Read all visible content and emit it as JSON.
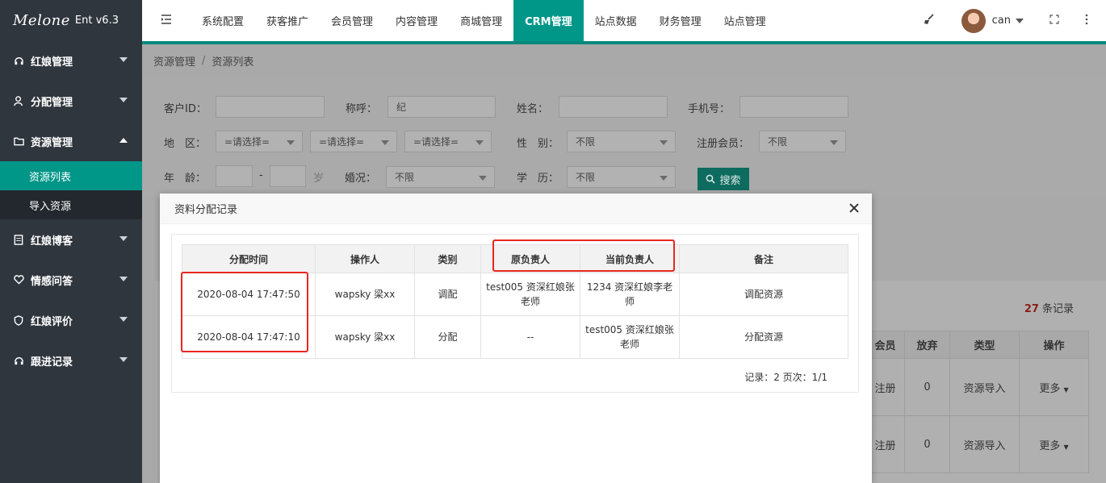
{
  "app": {
    "logo_text": "Melone",
    "version": "Ent v6.3"
  },
  "sidebar": {
    "items": [
      {
        "label": "红娘管理",
        "expanded": false
      },
      {
        "label": "分配管理",
        "expanded": false
      },
      {
        "label": "资源管理",
        "expanded": true,
        "children": [
          {
            "label": "资源列表",
            "active": true
          },
          {
            "label": "导入资源",
            "active": false
          }
        ]
      },
      {
        "label": "红娘博客",
        "expanded": false
      },
      {
        "label": "情感问答",
        "expanded": false
      },
      {
        "label": "红娘评价",
        "expanded": false
      },
      {
        "label": "跟进记录",
        "expanded": false
      }
    ]
  },
  "topnav": {
    "tabs": [
      "系统配置",
      "获客推广",
      "会员管理",
      "内容管理",
      "商城管理",
      "CRM管理",
      "站点数据",
      "财务管理",
      "站点管理"
    ],
    "active_tab": "CRM管理",
    "username": "can"
  },
  "breadcrumb": [
    "资源管理",
    "资源列表"
  ],
  "filters": {
    "customer_id": {
      "label": "客户ID：",
      "value": ""
    },
    "nickname": {
      "label": "称呼：",
      "value": "纪"
    },
    "name": {
      "label": "姓名：",
      "value": ""
    },
    "phone": {
      "label": "手机号：",
      "value": ""
    },
    "region": {
      "label": "地　区：",
      "selects": [
        "=请选择=",
        "=请选择=",
        "=请选择="
      ]
    },
    "gender": {
      "label": "性　别：",
      "value": "不限"
    },
    "registered": {
      "label": "注册会员：",
      "value": "不限"
    },
    "age": {
      "label": "年　龄：",
      "min": "",
      "dash": "-",
      "max": "",
      "unit": "岁"
    },
    "marital": {
      "label": "婚况：",
      "value": "不限"
    },
    "education": {
      "label": "学　历：",
      "value": "不限"
    },
    "search_button": "搜索"
  },
  "list": {
    "record_count": "27",
    "record_suffix": "条记录",
    "columns": [
      "会员",
      "放弃",
      "类型",
      "操作"
    ],
    "rows": [
      {
        "member": "注册",
        "abandon": "0",
        "type": "资源导入",
        "action": "更多"
      },
      {
        "member": "注册",
        "abandon": "0",
        "type": "资源导入",
        "action": "更多"
      }
    ]
  },
  "modal": {
    "title": "资料分配记录",
    "columns": [
      "分配时间",
      "操作人",
      "类别",
      "原负责人",
      "当前负责人",
      "备注"
    ],
    "rows": [
      {
        "time": "2020-08-04 17:47:50",
        "operator": "wapsky 梁xx",
        "category": "调配",
        "original": "test005 资深红娘张老师",
        "current": "1234 资深红娘李老师",
        "note": "调配资源"
      },
      {
        "time": "2020-08-04 17:47:10",
        "operator": "wapsky 梁xx",
        "category": "分配",
        "original": "--",
        "current": "test005 资深红娘张老师",
        "note": "分配资源"
      }
    ],
    "pager": "记录：2  页次：1/1"
  },
  "colors": {
    "accent": "#009688",
    "sidebar_bg": "#30363e",
    "highlight": "#e8271f"
  }
}
